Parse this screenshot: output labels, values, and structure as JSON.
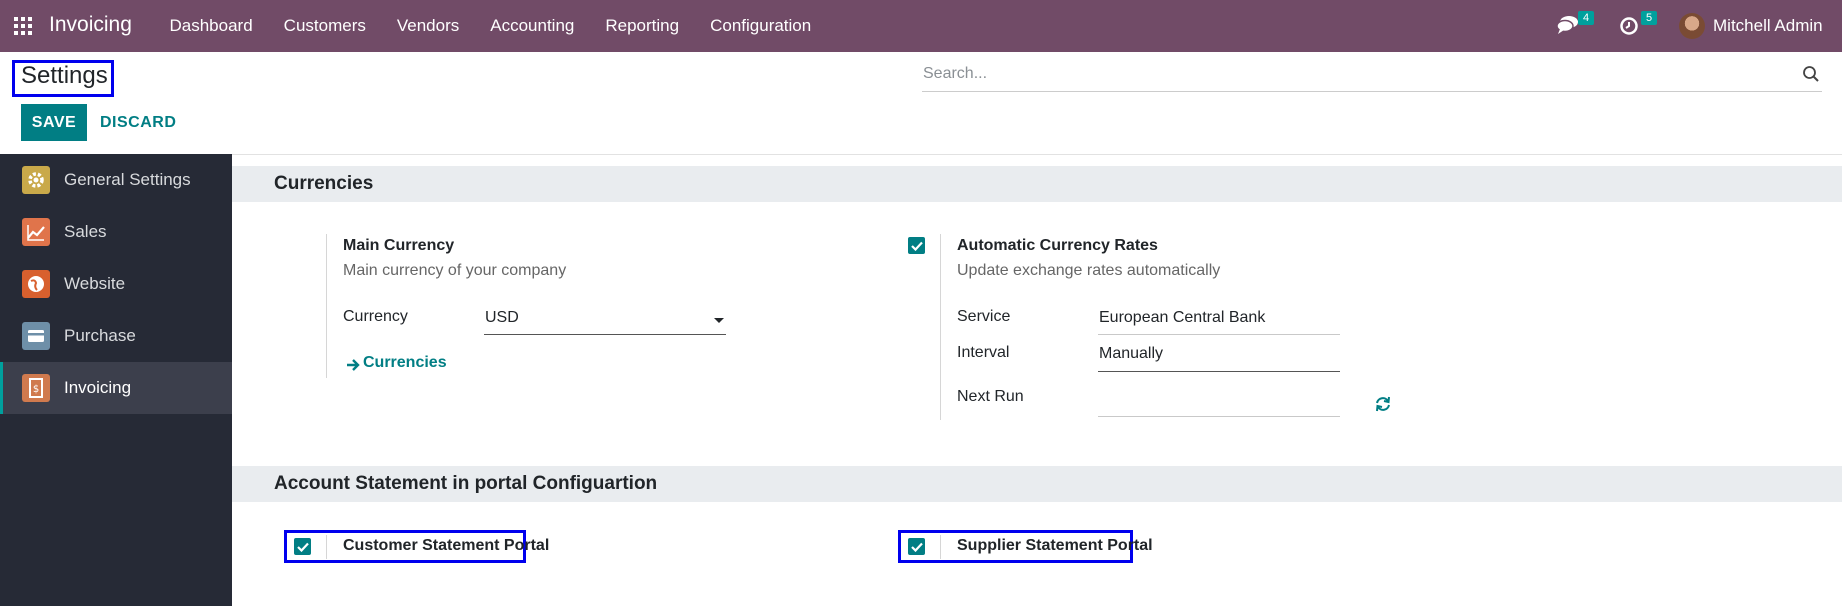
{
  "navbar": {
    "app_name": "Invoicing",
    "menu": [
      "Dashboard",
      "Customers",
      "Vendors",
      "Accounting",
      "Reporting",
      "Configuration"
    ],
    "messages_count": "4",
    "activities_count": "5",
    "user_name": "Mitchell Admin",
    "bg_color": "#714B67"
  },
  "control": {
    "title": "Settings",
    "search_placeholder": "Search...",
    "save_label": "SAVE",
    "discard_label": "DISCARD"
  },
  "sidebar": {
    "items": [
      {
        "label": "General Settings",
        "icon": "gear-icon",
        "color": "#C9A94A"
      },
      {
        "label": "Sales",
        "icon": "chart-icon",
        "color": "#E0744B"
      },
      {
        "label": "Website",
        "icon": "globe-icon",
        "color": "#D8602E"
      },
      {
        "label": "Purchase",
        "icon": "card-icon",
        "color": "#6E8FA8"
      },
      {
        "label": "Invoicing",
        "icon": "invoice-icon",
        "color": "#D07A4E"
      }
    ],
    "active": "Invoicing"
  },
  "currencies": {
    "section_title": "Currencies",
    "main_currency": {
      "title": "Main Currency",
      "description": "Main currency of your company",
      "currency_label": "Currency",
      "currency_value": "USD",
      "link_label": "Currencies"
    },
    "auto_rates": {
      "checked": true,
      "title": "Automatic Currency Rates",
      "description": "Update exchange rates automatically",
      "service_label": "Service",
      "service_value": "European Central Bank",
      "interval_label": "Interval",
      "interval_value": "Manually",
      "next_run_label": "Next Run",
      "next_run_value": ""
    }
  },
  "portal": {
    "section_title": "Account Statement in portal Configuartion",
    "customer_label": "Customer Statement Portal",
    "customer_checked": true,
    "supplier_label": "Supplier Statement Portal",
    "supplier_checked": true
  }
}
